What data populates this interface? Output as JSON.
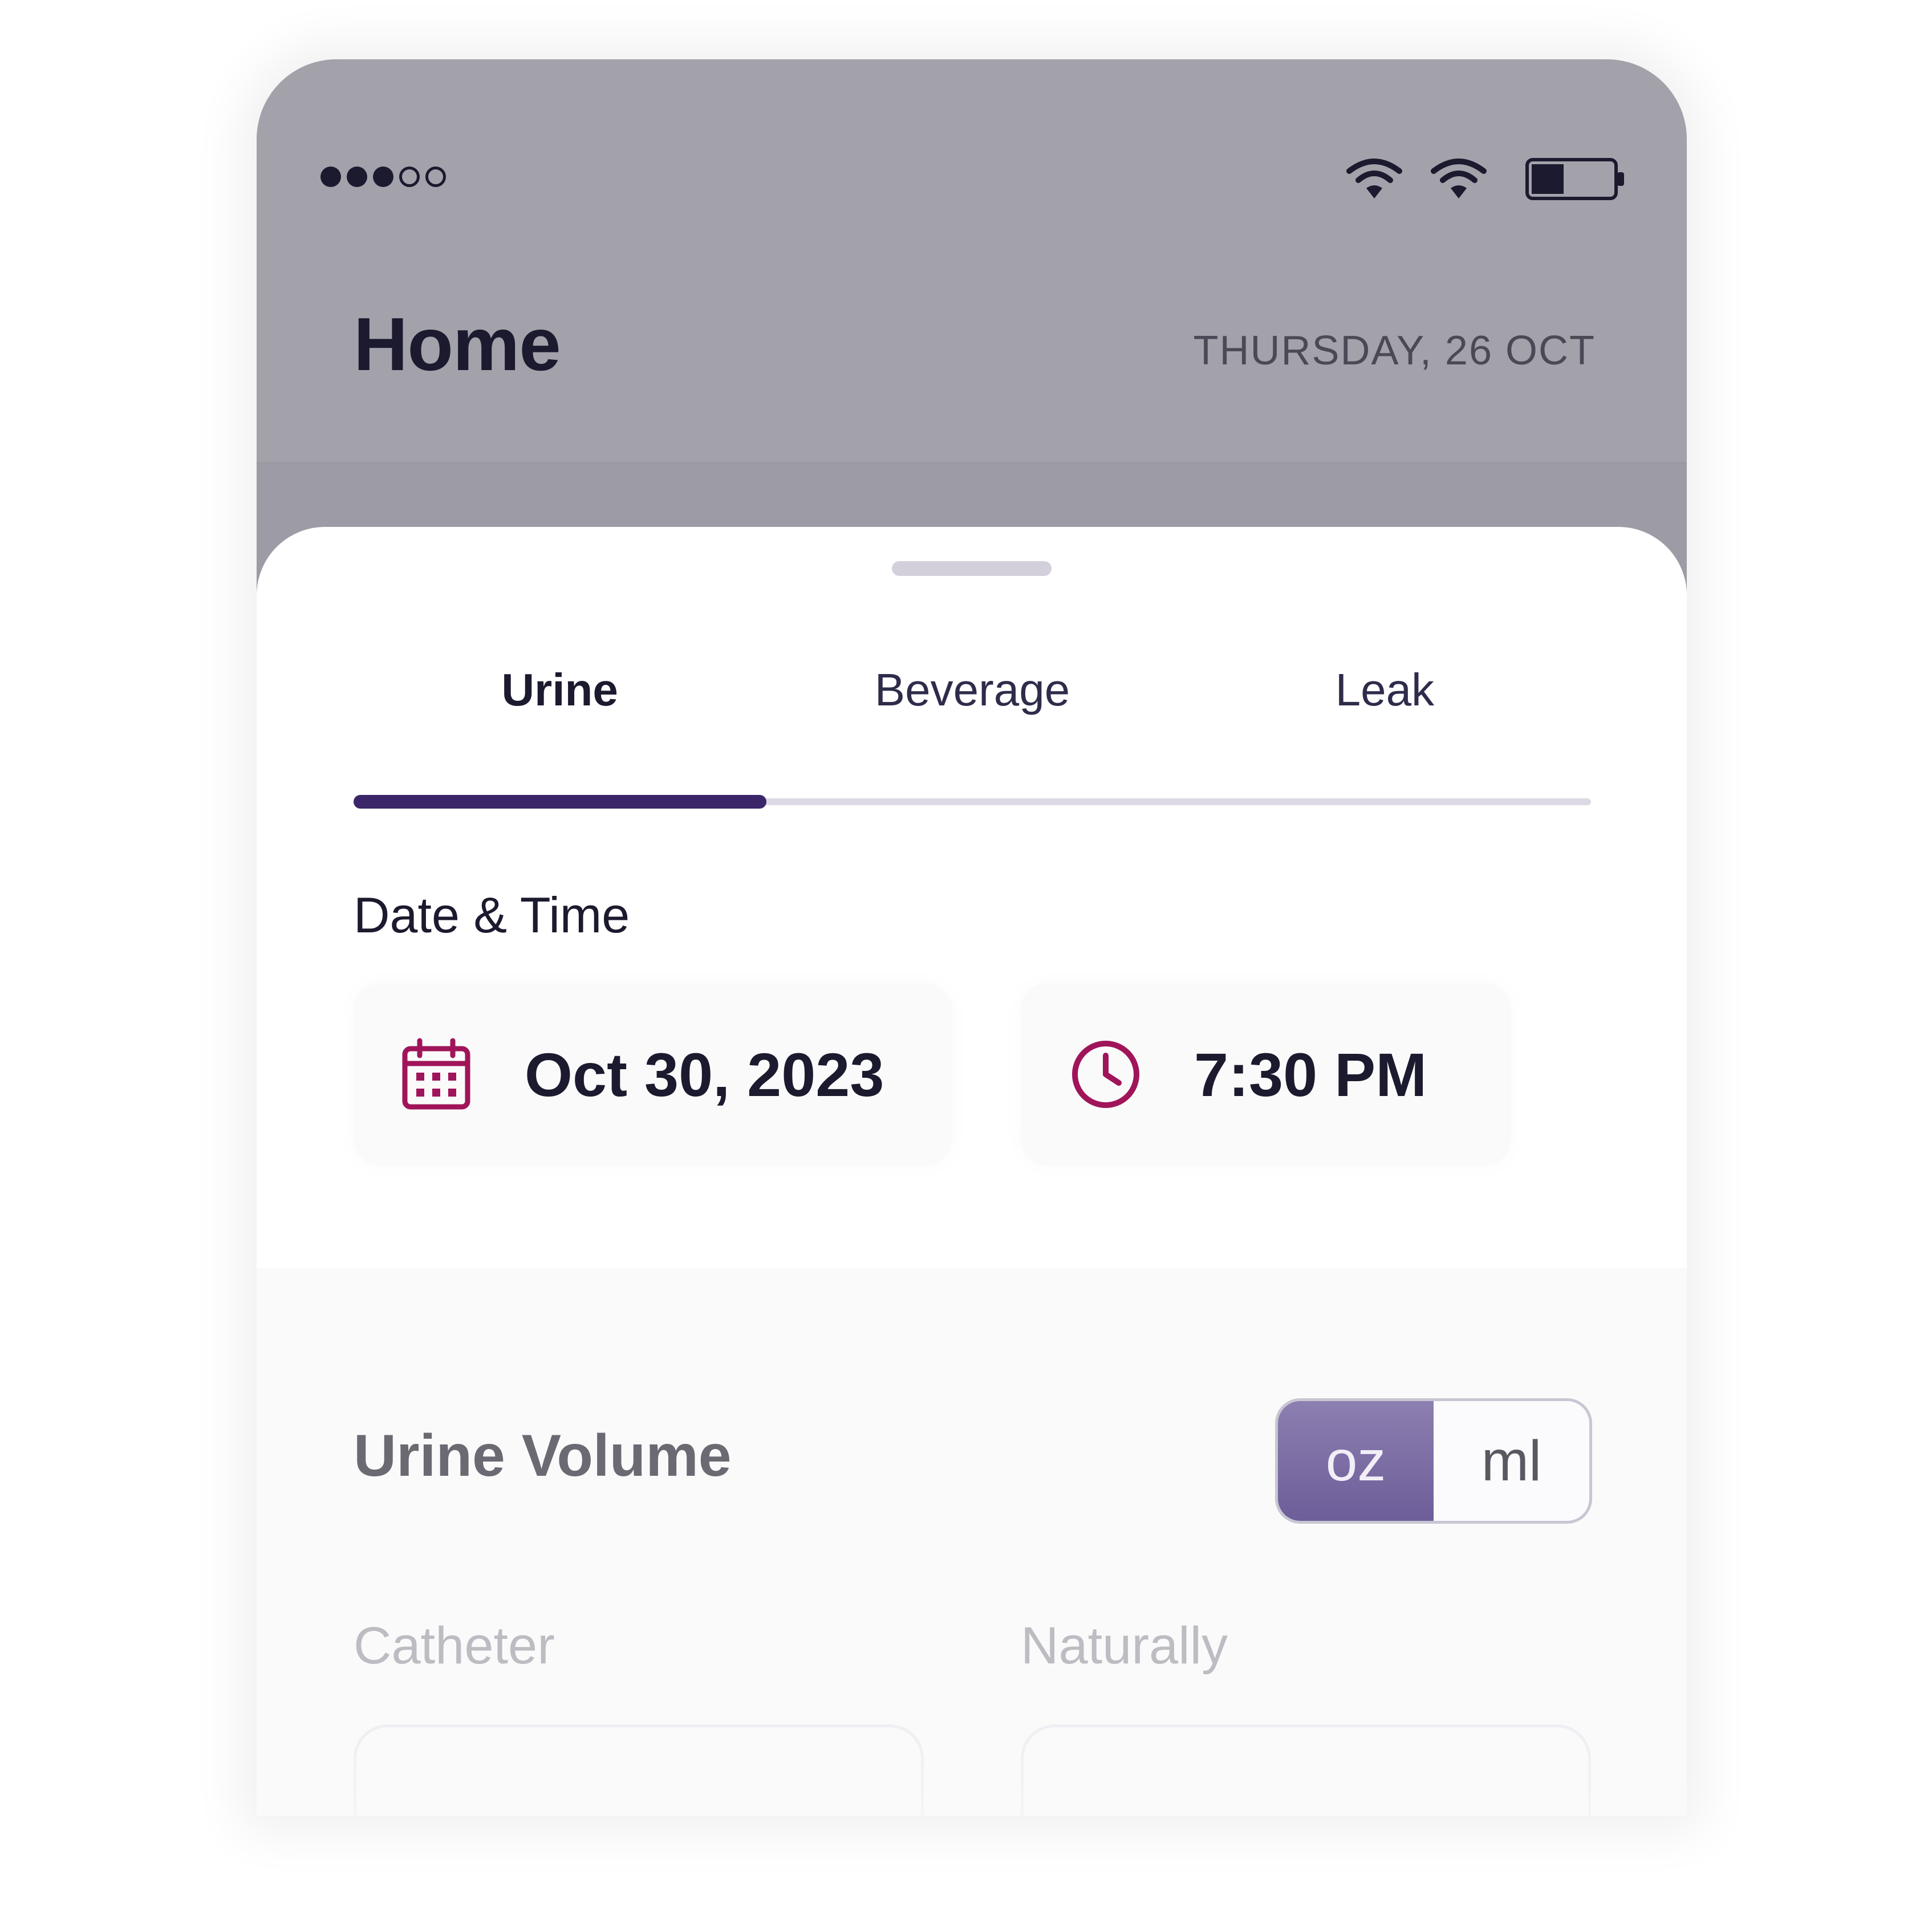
{
  "status_bar": {
    "signal_dots": [
      "on",
      "on",
      "on",
      "off",
      "off"
    ],
    "icons": [
      "wifi-icon",
      "wifi-icon",
      "battery-icon"
    ],
    "battery_level": 0.4
  },
  "header": {
    "title": "Home",
    "date": "THURSDAY, 26 OCT"
  },
  "tabs": [
    {
      "label": "Urine",
      "active": true
    },
    {
      "label": "Beverage",
      "active": false
    },
    {
      "label": "Leak",
      "active": false
    }
  ],
  "date_time": {
    "label": "Date & Time",
    "date_value": "Oct 30, 2023",
    "date_icon": "calendar-icon",
    "time_value": "7:30 PM",
    "time_icon": "clock-icon"
  },
  "urine_volume": {
    "label": "Urine Volume",
    "units": [
      {
        "label": "oz",
        "active": true
      },
      {
        "label": "ml",
        "active": false
      }
    ],
    "fields": [
      {
        "label": "Catheter",
        "value": ""
      },
      {
        "label": "Naturally",
        "value": ""
      }
    ]
  },
  "colors": {
    "accent": "#3a2668",
    "icon_magenta": "#a0145a",
    "toggle_active": "#7a6ba3",
    "header_bg": "#a3a2ab"
  }
}
